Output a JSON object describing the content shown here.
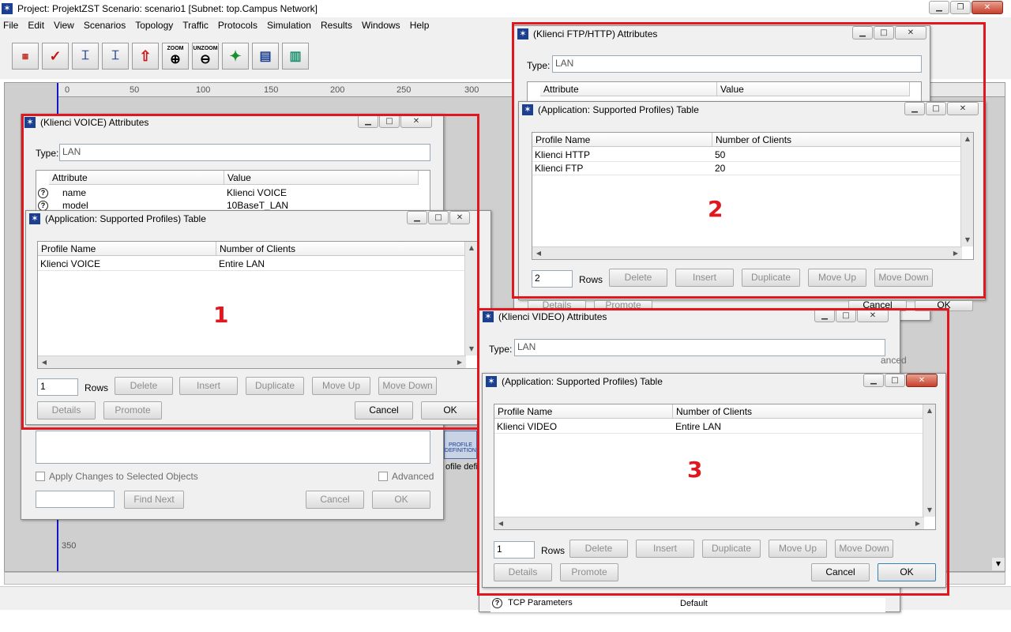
{
  "main_window": {
    "title": "Project: ProjektZST Scenario: scenario1  [Subnet: top.Campus Network]",
    "menu": [
      "File",
      "Edit",
      "View",
      "Scenarios",
      "Topology",
      "Traffic",
      "Protocols",
      "Simulation",
      "Results",
      "Windows",
      "Help"
    ],
    "toolbar_icons": [
      "palette-icon",
      "verify-links-icon",
      "failure-icon",
      "recover-icon",
      "return-to-parent-icon",
      "zoom-icon",
      "unzoom-icon",
      "configure-simulation-icon",
      "view-results-icon",
      "hide-results-icon"
    ],
    "zoom_label": "ZOOM",
    "unzoom_label": "UNZOOM",
    "ruler_ticks": [
      "0",
      "50",
      "100",
      "150",
      "200",
      "250",
      "300"
    ],
    "ruler_left_tick": "350",
    "profile_node_label": "PROFILE DEFINITION",
    "profile_node_caption": "ofile defi"
  },
  "voice_attr": {
    "title": "(Klienci VOICE) Attributes",
    "type_label": "Type:",
    "type_value": "LAN",
    "col_attribute": "Attribute",
    "col_value": "Value",
    "rows": [
      {
        "attribute": "name",
        "value": "Klienci VOICE"
      },
      {
        "attribute": "model",
        "value": "10BaseT_LAN"
      }
    ],
    "apply_label": "Apply Changes to Selected Objects",
    "advanced_label": "Advanced",
    "find_next": "Find Next",
    "cancel": "Cancel",
    "ok": "OK"
  },
  "voice_table": {
    "title": "(Application: Supported Profiles) Table",
    "col_profile": "Profile Name",
    "col_clients": "Number of Clients",
    "rows": [
      {
        "profile": "Klienci VOICE",
        "clients": "Entire LAN"
      }
    ],
    "rows_count": "1",
    "annotation": "1"
  },
  "ftp_attr": {
    "title": "(Klienci FTP/HTTP) Attributes",
    "type_label": "Type:",
    "type_value": "LAN",
    "col_attribute": "Attribute",
    "col_value": "Value"
  },
  "ftp_table": {
    "title": "(Application: Supported Profiles) Table",
    "col_profile": "Profile Name",
    "col_clients": "Number of Clients",
    "rows": [
      {
        "profile": "Klienci HTTP",
        "clients": "50"
      },
      {
        "profile": "Klienci FTP",
        "clients": "20"
      }
    ],
    "rows_count": "2",
    "annotation": "2"
  },
  "video_attr": {
    "title": "(Klienci VIDEO) Attributes",
    "type_label": "Type:",
    "type_value": "LAN",
    "tcp_row_label": "TCP Parameters",
    "tcp_row_value": "Default",
    "advanced_partial": "anced"
  },
  "video_table": {
    "title": "(Application: Supported Profiles) Table",
    "col_profile": "Profile Name",
    "col_clients": "Number of Clients",
    "rows": [
      {
        "profile": "Klienci VIDEO",
        "clients": "Entire LAN"
      }
    ],
    "rows_count": "1",
    "annotation": "3"
  },
  "buttons": {
    "rows": "Rows",
    "delete": "Delete",
    "insert": "Insert",
    "duplicate": "Duplicate",
    "move_up": "Move Up",
    "move_down": "Move Down",
    "details": "Details",
    "promote": "Promote",
    "cancel": "Cancel",
    "ok": "OK"
  },
  "colors": {
    "annotation_red": "#e0171f",
    "title_star_blue": "#1c3f8f",
    "canvas_blue_line": "#1515c8"
  }
}
